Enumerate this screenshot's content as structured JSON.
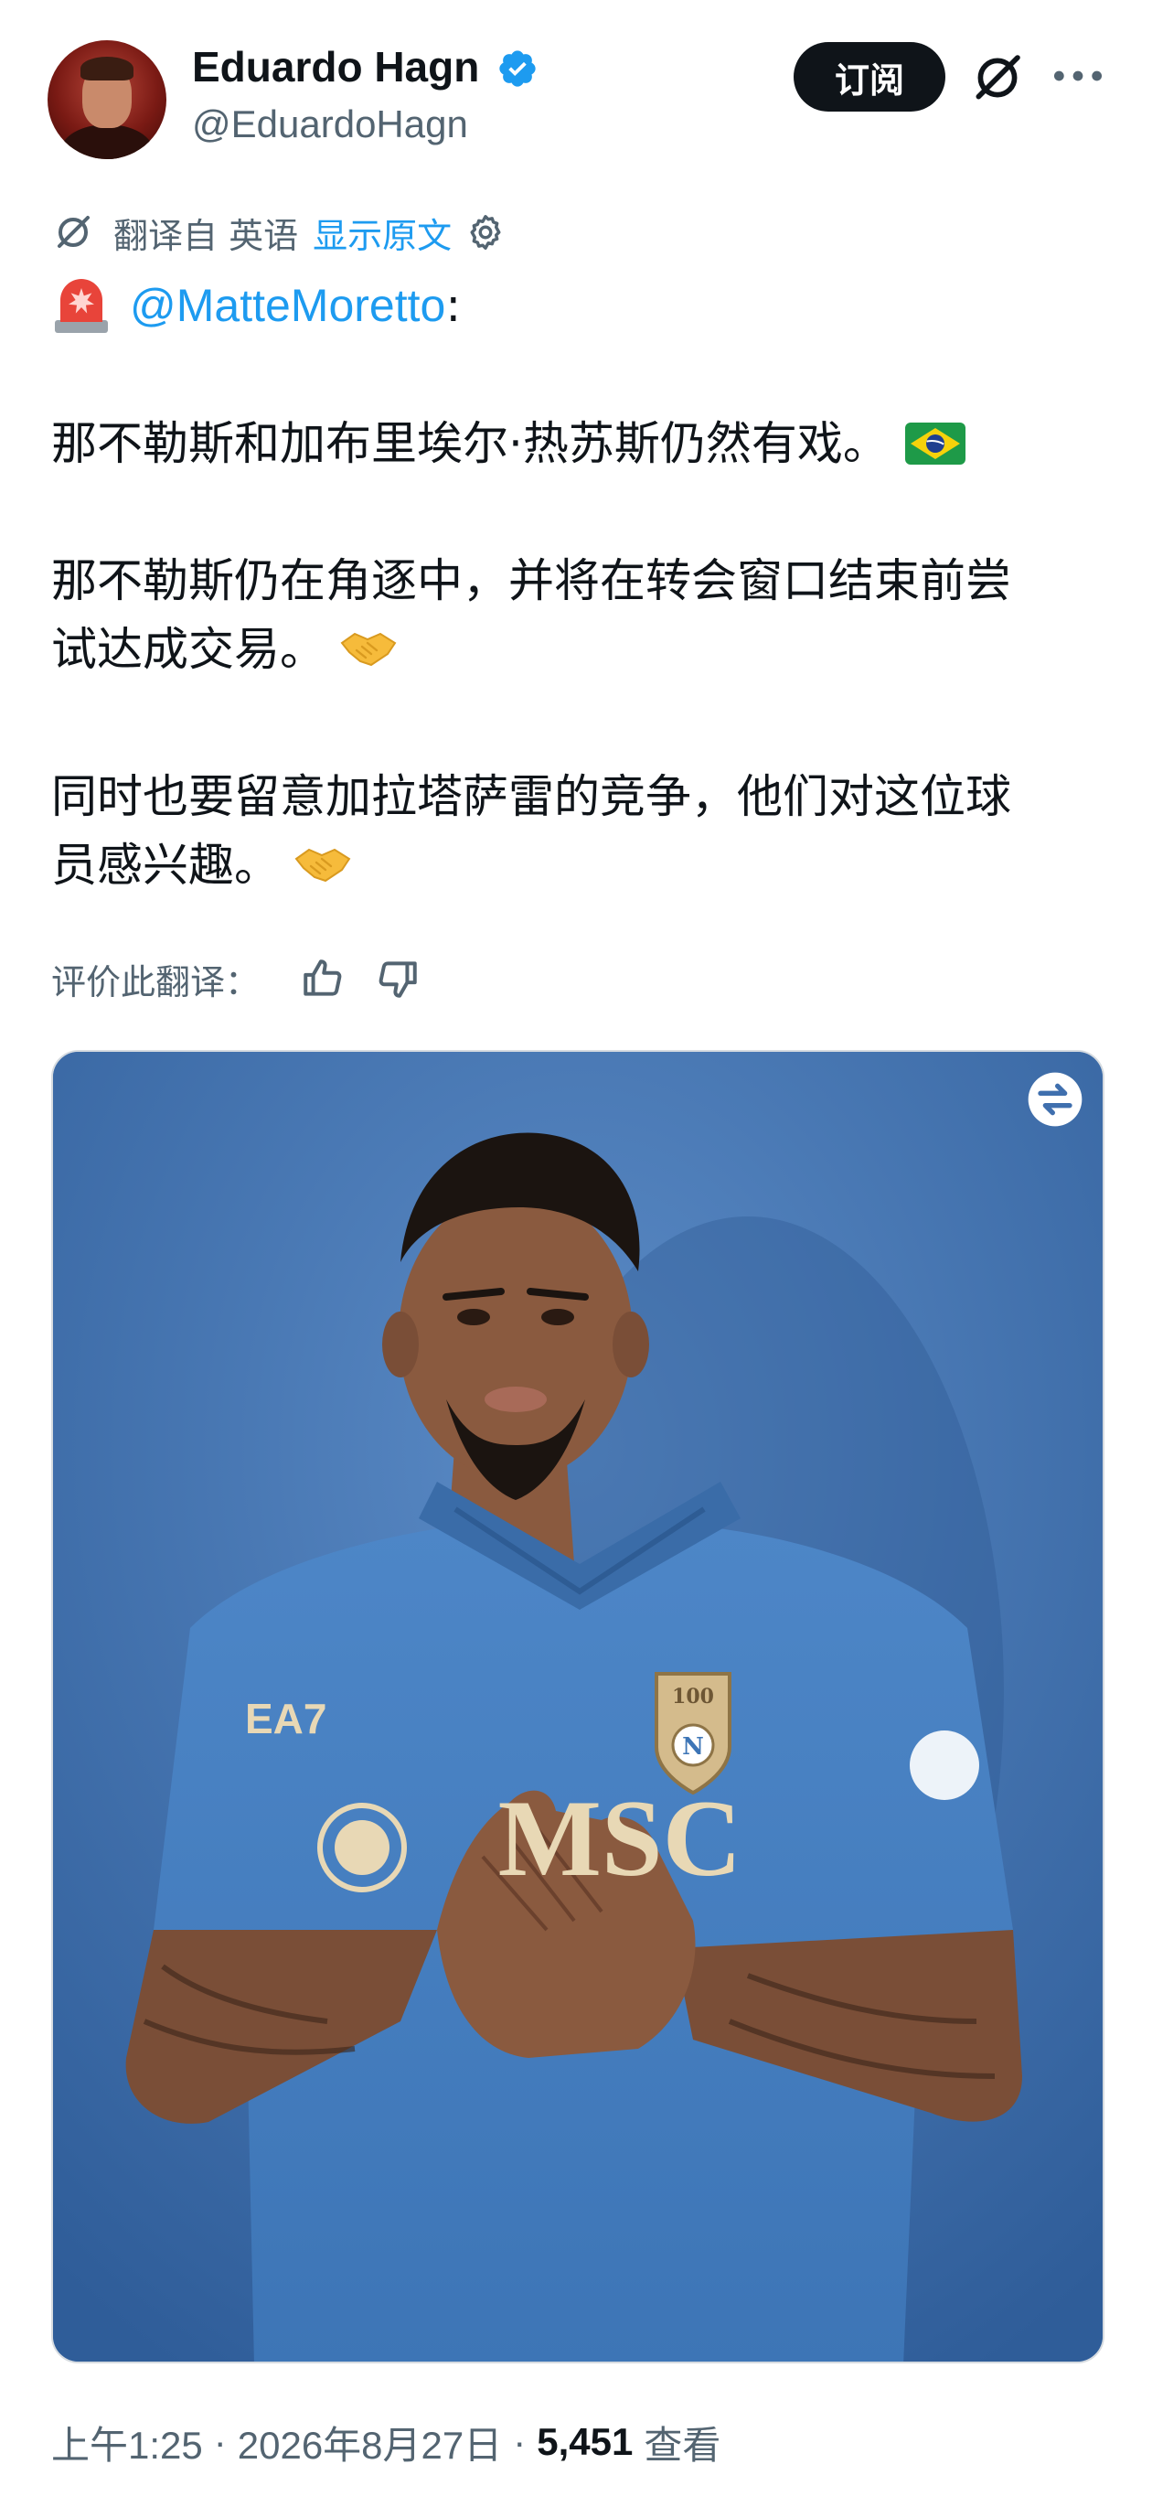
{
  "author": {
    "display_name": "Eduardo Hagn",
    "handle": "@EduardoHagn",
    "verified_icon": "verified-badge-icon"
  },
  "header": {
    "subscribe_label": "订阅"
  },
  "translation": {
    "translated_from": "翻译自 英语",
    "show_original": "显示原文"
  },
  "tweet": {
    "mention": "@MatteMoretto",
    "colon": ":",
    "paragraphs": [
      {
        "lines": [
          "那不勒斯和加布里埃尔·热苏斯仍然有戏。"
        ]
      },
      {
        "lines": [
          "那不勒斯仍在角逐中，并将在转会窗口结束前尝",
          "试达成交易。"
        ]
      },
      {
        "lines": [
          "同时也要留意加拉塔萨雷的竞争，他们对这位球",
          "员感兴趣。"
        ]
      }
    ]
  },
  "rate": {
    "label": "评价此翻译："
  },
  "photo": {
    "jersey_brand": "EA7",
    "sponsor": "MSC",
    "crest_number": "100",
    "crest_letter": "N",
    "accent_background": "#3f6fae"
  },
  "meta": {
    "time": "上午1:25",
    "sep1": "·",
    "date": "2026年8月27日",
    "sep2": "·",
    "views": "5,451",
    "views_label": "查看"
  },
  "colors": {
    "link": "#1d9bf0",
    "text": "#0f1419",
    "secondary": "#536471"
  }
}
